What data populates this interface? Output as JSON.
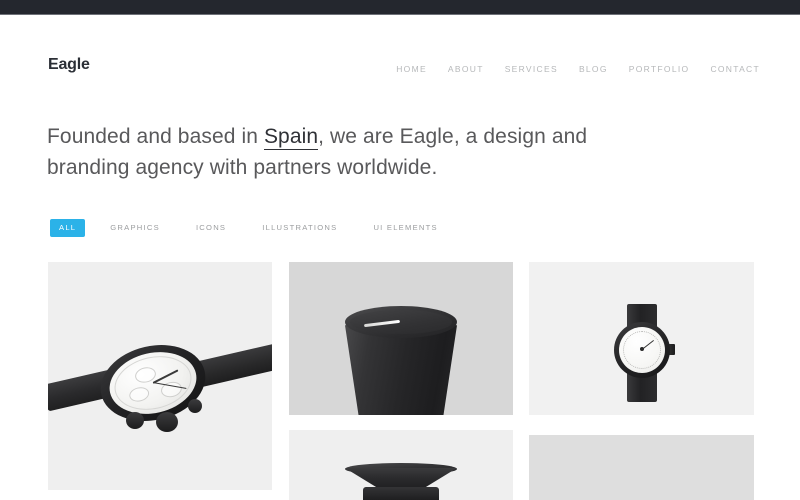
{
  "site": {
    "logo": "Eagle"
  },
  "nav": {
    "items": [
      {
        "label": "HOME"
      },
      {
        "label": "ABOUT"
      },
      {
        "label": "SERVICES"
      },
      {
        "label": "BLOG"
      },
      {
        "label": "PORTFOLIO"
      },
      {
        "label": "CONTACT"
      }
    ]
  },
  "hero": {
    "line1_before": "Founded and based in ",
    "accent": "Spain",
    "line1_after": ", we are Eagle, a design and",
    "line2": "branding agency with partners worldwide."
  },
  "filters": {
    "items": [
      {
        "label": "ALL",
        "active": true
      },
      {
        "label": "GRAPHICS",
        "active": false
      },
      {
        "label": "ICONS",
        "active": false
      },
      {
        "label": "ILLUSTRATIONS",
        "active": false
      },
      {
        "label": "UI ELEMENTS",
        "active": false
      }
    ],
    "active_color": "#2bb2e8",
    "active_text_color": "#ffffff",
    "inactive_text_color": "#9b9d9f"
  },
  "gallery": {
    "items": [
      {
        "subject": "black-chronograph-watch",
        "background": "#efefef"
      },
      {
        "subject": "black-conical-knob",
        "background": "#d7d7d7"
      },
      {
        "subject": "minimal-round-watch",
        "background": "#f1f1f1"
      },
      {
        "subject": "black-funnel-object",
        "background": "#efefef"
      },
      {
        "subject": "empty-placeholder",
        "background": "#dedede"
      }
    ]
  },
  "colors": {
    "topbar": "#24272e",
    "logo_text": "#2b2f36",
    "nav_text": "#b6b8ba",
    "headline_text": "#59595b",
    "headline_accent": "#2f3136",
    "page_background": "#ffffff"
  }
}
